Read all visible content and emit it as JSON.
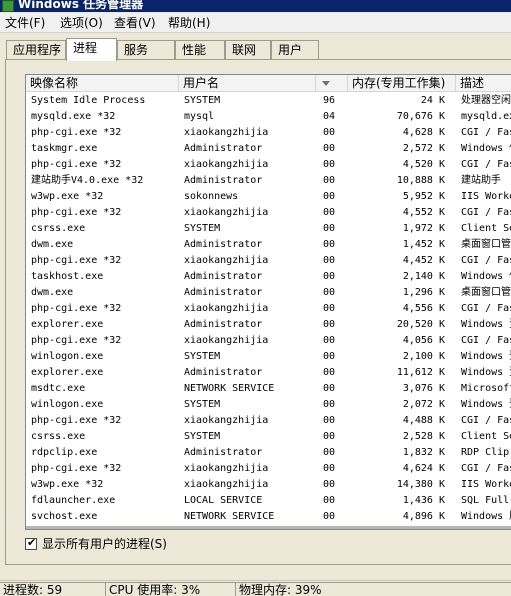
{
  "window": {
    "title": "Windows 任务管理器"
  },
  "menu": [
    {
      "label": "文件(F)"
    },
    {
      "label": "选项(O)"
    },
    {
      "label": "查看(V)"
    },
    {
      "label": "帮助(H)"
    }
  ],
  "tabs": [
    {
      "label": "应用程序",
      "active": false
    },
    {
      "label": "进程",
      "active": true
    },
    {
      "label": "服务",
      "active": false
    },
    {
      "label": "性能",
      "active": false
    },
    {
      "label": "联网",
      "active": false
    },
    {
      "label": "用户",
      "active": false
    }
  ],
  "columns": {
    "name": "映像名称",
    "user": "用户名",
    "cpu": "",
    "memory": "内存(专用工作集)",
    "description": "描述"
  },
  "processes": [
    {
      "name": "System Idle Process",
      "user": "SYSTEM",
      "cpu": "96",
      "memory": "24 K",
      "description": "处理器空闲"
    },
    {
      "name": "mysqld.exe *32",
      "user": "mysql",
      "cpu": "04",
      "memory": "70,676 K",
      "description": "mysqld.exe"
    },
    {
      "name": "php-cgi.exe *32",
      "user": "xiaokangzhijia",
      "cpu": "00",
      "memory": "4,628 K",
      "description": "CGI / FastCGI"
    },
    {
      "name": "taskmgr.exe",
      "user": "Administrator",
      "cpu": "00",
      "memory": "2,572 K",
      "description": "Windows 任务"
    },
    {
      "name": "php-cgi.exe *32",
      "user": "xiaokangzhijia",
      "cpu": "00",
      "memory": "4,520 K",
      "description": "CGI / FastCGI"
    },
    {
      "name": "建站助手V4.0.exe *32",
      "user": "Administrator",
      "cpu": "00",
      "memory": "10,888 K",
      "description": "建站助手"
    },
    {
      "name": "w3wp.exe *32",
      "user": "sokonnews",
      "cpu": "00",
      "memory": "5,952 K",
      "description": "IIS Worker"
    },
    {
      "name": "php-cgi.exe *32",
      "user": "xiaokangzhijia",
      "cpu": "00",
      "memory": "4,552 K",
      "description": "CGI / FastCGI"
    },
    {
      "name": "csrss.exe",
      "user": "SYSTEM",
      "cpu": "00",
      "memory": "1,972 K",
      "description": "Client Server"
    },
    {
      "name": "dwm.exe",
      "user": "Administrator",
      "cpu": "00",
      "memory": "1,452 K",
      "description": "桌面窗口管理器"
    },
    {
      "name": "php-cgi.exe *32",
      "user": "xiaokangzhijia",
      "cpu": "00",
      "memory": "4,452 K",
      "description": "CGI / FastCGI"
    },
    {
      "name": "taskhost.exe",
      "user": "Administrator",
      "cpu": "00",
      "memory": "2,140 K",
      "description": "Windows 任务"
    },
    {
      "name": "dwm.exe",
      "user": "Administrator",
      "cpu": "00",
      "memory": "1,296 K",
      "description": "桌面窗口管理器"
    },
    {
      "name": "php-cgi.exe *32",
      "user": "xiaokangzhijia",
      "cpu": "00",
      "memory": "4,556 K",
      "description": "CGI / FastCGI"
    },
    {
      "name": "explorer.exe",
      "user": "Administrator",
      "cpu": "00",
      "memory": "20,520 K",
      "description": "Windows 资源"
    },
    {
      "name": "php-cgi.exe *32",
      "user": "xiaokangzhijia",
      "cpu": "00",
      "memory": "4,056 K",
      "description": "CGI / FastCGI"
    },
    {
      "name": "winlogon.exe",
      "user": "SYSTEM",
      "cpu": "00",
      "memory": "2,100 K",
      "description": "Windows 登录"
    },
    {
      "name": "explorer.exe",
      "user": "Administrator",
      "cpu": "00",
      "memory": "11,612 K",
      "description": "Windows 资源"
    },
    {
      "name": "msdtc.exe",
      "user": "NETWORK SERVICE",
      "cpu": "00",
      "memory": "3,076 K",
      "description": "Microsoft"
    },
    {
      "name": "winlogon.exe",
      "user": "SYSTEM",
      "cpu": "00",
      "memory": "2,072 K",
      "description": "Windows 登录"
    },
    {
      "name": "php-cgi.exe *32",
      "user": "xiaokangzhijia",
      "cpu": "00",
      "memory": "4,488 K",
      "description": "CGI / FastCGI"
    },
    {
      "name": "csrss.exe",
      "user": "SYSTEM",
      "cpu": "00",
      "memory": "2,528 K",
      "description": "Client Server"
    },
    {
      "name": "rdpclip.exe",
      "user": "Administrator",
      "cpu": "00",
      "memory": "1,832 K",
      "description": "RDP Clip"
    },
    {
      "name": "php-cgi.exe *32",
      "user": "xiaokangzhijia",
      "cpu": "00",
      "memory": "4,624 K",
      "description": "CGI / FastCGI"
    },
    {
      "name": "w3wp.exe *32",
      "user": "xiaokangzhijia",
      "cpu": "00",
      "memory": "14,380 K",
      "description": "IIS Worker"
    },
    {
      "name": "fdlauncher.exe",
      "user": "LOCAL SERVICE",
      "cpu": "00",
      "memory": "1,436 K",
      "description": "SQL Full-text"
    },
    {
      "name": "svchost.exe",
      "user": "NETWORK SERVICE",
      "cpu": "00",
      "memory": "4,896 K",
      "description": "Windows 服务"
    }
  ],
  "show_all": {
    "label": "显示所有用户的进程(S)",
    "checked": true
  },
  "status": {
    "processes": "进程数: 59",
    "cpu": "CPU 使用率: 3%",
    "memory": "物理内存: 39%"
  },
  "colors": {
    "titlebar": "#0a246a",
    "face": "#ece9d8",
    "list_bg": "#ffffff"
  }
}
